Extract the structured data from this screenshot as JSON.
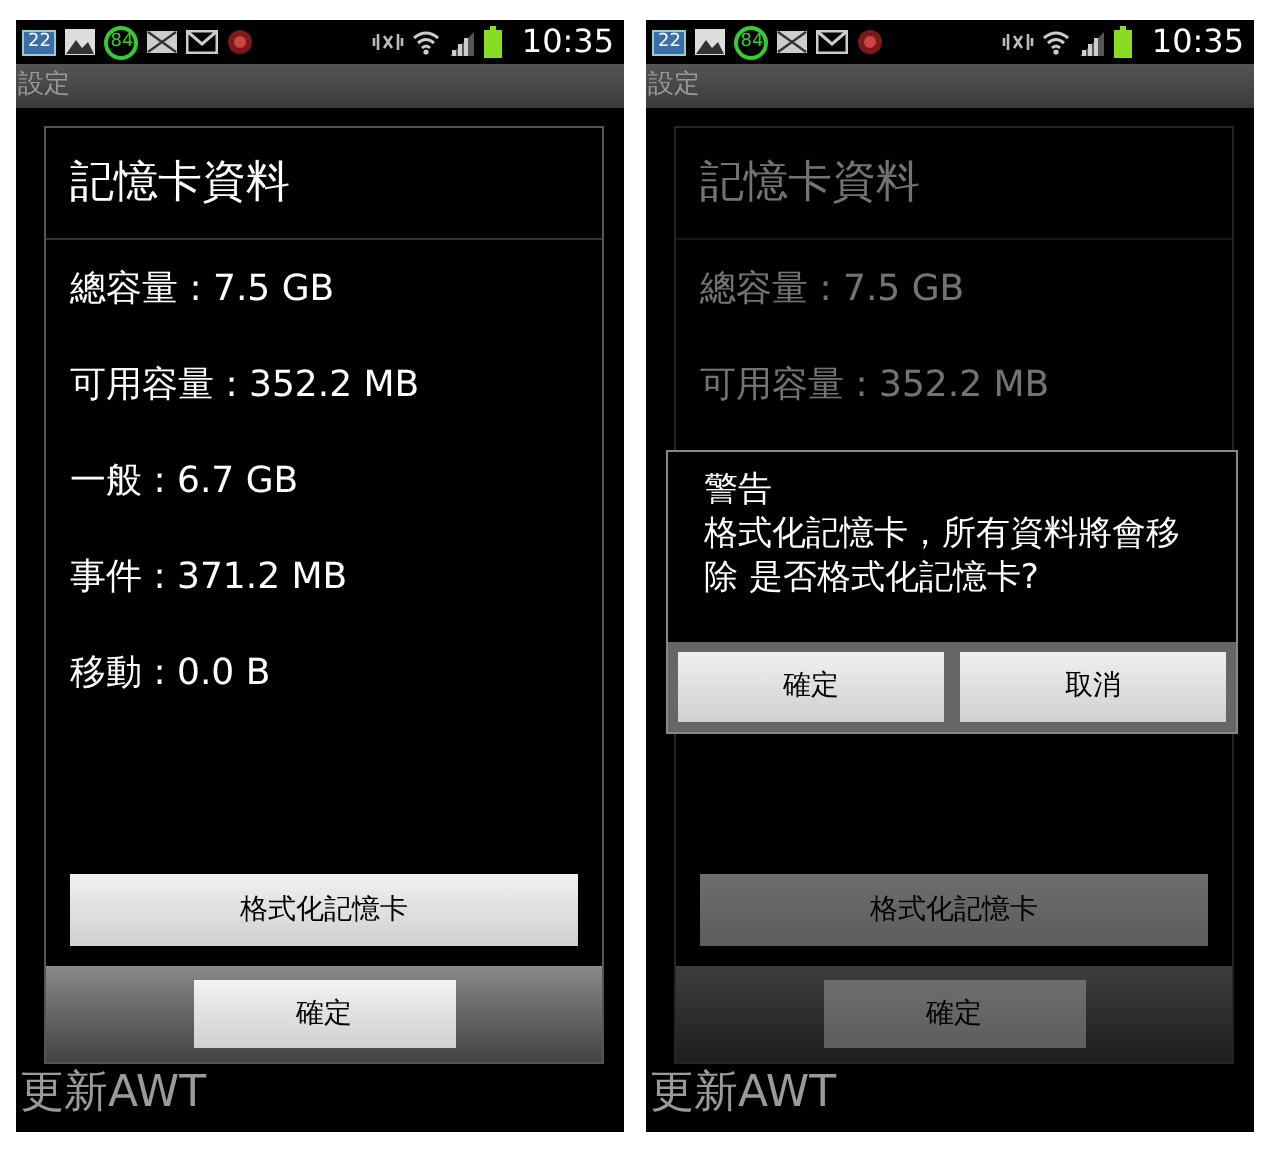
{
  "screens": [
    {
      "status_bar": {
        "calendar_day": "22",
        "counter": "84",
        "time": "10:35"
      },
      "title": "設定",
      "dimmed": false,
      "dialog": {
        "title": "記憶卡資料",
        "rows": [
          "總容量 : 7.5 GB",
          "可用容量 : 352.2 MB",
          "一般 : 6.7 GB",
          "事件 : 371.2 MB",
          "移動 : 0.0 B"
        ],
        "format_button": "格式化記憶卡",
        "ok_button": "確定"
      },
      "below_text": "更新AWT"
    },
    {
      "status_bar": {
        "calendar_day": "22",
        "counter": "84",
        "time": "10:35"
      },
      "title": "設定",
      "dimmed": true,
      "dialog": {
        "title": "記憶卡資料",
        "rows": [
          "總容量 : 7.5 GB",
          "可用容量 : 352.2 MB"
        ],
        "format_button": "格式化記憶卡",
        "ok_button": "確定"
      },
      "alert": {
        "title": "警告",
        "message": "格式化記憶卡，所有資料將會移除 是否格式化記憶卡?",
        "buttons": [
          "確定",
          "取消"
        ]
      },
      "below_text": "更新AWT"
    }
  ]
}
